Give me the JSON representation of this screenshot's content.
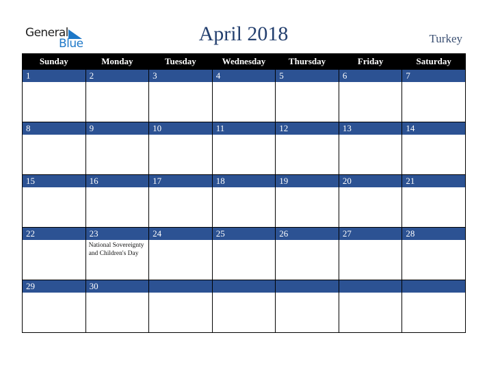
{
  "logo": {
    "word1": "General",
    "word2": "Blue",
    "icon": "triangle-flag-icon",
    "accent": "#1e78c8"
  },
  "header": {
    "title": "April 2018",
    "country": "Turkey",
    "title_color": "#233f6e"
  },
  "colors": {
    "header_bg": "#000000",
    "band_bg": "#2c5293"
  },
  "days": [
    "Sunday",
    "Monday",
    "Tuesday",
    "Wednesday",
    "Thursday",
    "Friday",
    "Saturday"
  ],
  "weeks": [
    [
      {
        "d": "1"
      },
      {
        "d": "2"
      },
      {
        "d": "3"
      },
      {
        "d": "4"
      },
      {
        "d": "5"
      },
      {
        "d": "6"
      },
      {
        "d": "7"
      }
    ],
    [
      {
        "d": "8"
      },
      {
        "d": "9"
      },
      {
        "d": "10"
      },
      {
        "d": "11"
      },
      {
        "d": "12"
      },
      {
        "d": "13"
      },
      {
        "d": "14"
      }
    ],
    [
      {
        "d": "15"
      },
      {
        "d": "16"
      },
      {
        "d": "17"
      },
      {
        "d": "18"
      },
      {
        "d": "19"
      },
      {
        "d": "20"
      },
      {
        "d": "21"
      }
    ],
    [
      {
        "d": "22"
      },
      {
        "d": "23",
        "event": "National Sovereignty and Children's Day"
      },
      {
        "d": "24"
      },
      {
        "d": "25"
      },
      {
        "d": "26"
      },
      {
        "d": "27"
      },
      {
        "d": "28"
      }
    ],
    [
      {
        "d": "29"
      },
      {
        "d": "30"
      },
      {
        "d": ""
      },
      {
        "d": ""
      },
      {
        "d": ""
      },
      {
        "d": ""
      },
      {
        "d": ""
      }
    ]
  ]
}
